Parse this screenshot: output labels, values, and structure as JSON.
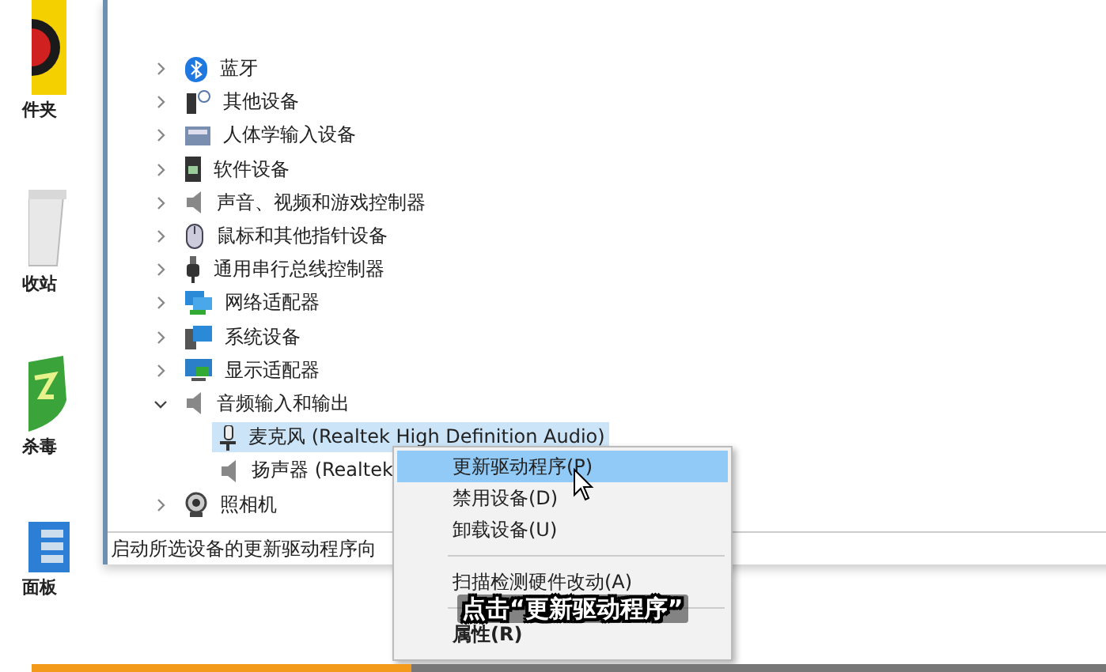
{
  "desktop_icons": [
    {
      "label": "件夹"
    },
    {
      "label": "收站"
    },
    {
      "label": "杀毒"
    },
    {
      "label": "面板"
    }
  ],
  "device_tree": [
    {
      "label": "蓝牙",
      "expanded": false
    },
    {
      "label": "其他设备",
      "expanded": false
    },
    {
      "label": "人体学输入设备",
      "expanded": false
    },
    {
      "label": "软件设备",
      "expanded": false
    },
    {
      "label": "声音、视频和游戏控制器",
      "expanded": false
    },
    {
      "label": "鼠标和其他指针设备",
      "expanded": false
    },
    {
      "label": "通用串行总线控制器",
      "expanded": false
    },
    {
      "label": "网络适配器",
      "expanded": false
    },
    {
      "label": "系统设备",
      "expanded": false
    },
    {
      "label": "显示适配器",
      "expanded": false
    },
    {
      "label": "音频输入和输出",
      "expanded": true,
      "children": [
        {
          "label": "麦克风 (Realtek High Definition Audio)",
          "selected": true
        },
        {
          "label": "扬声器 (Realtek",
          "selected": false
        }
      ]
    },
    {
      "label": "照相机",
      "expanded": false
    }
  ],
  "status_bar": "启动所选设备的更新驱动程序向",
  "context_menu": [
    {
      "label": "更新驱动程序(P)",
      "selected": true,
      "bold": false
    },
    {
      "label": "禁用设备(D)",
      "selected": false,
      "bold": false
    },
    {
      "label": "卸载设备(U)",
      "selected": false,
      "bold": false
    },
    {
      "kind": "separator"
    },
    {
      "label": "扫描检测硬件改动(A)",
      "selected": false,
      "bold": false
    },
    {
      "kind": "separator"
    },
    {
      "label": "属性(R)",
      "selected": false,
      "bold": true
    }
  ],
  "subtitle": "点击“更新驱动程序”",
  "video_progress": {
    "level": 0.353
  }
}
